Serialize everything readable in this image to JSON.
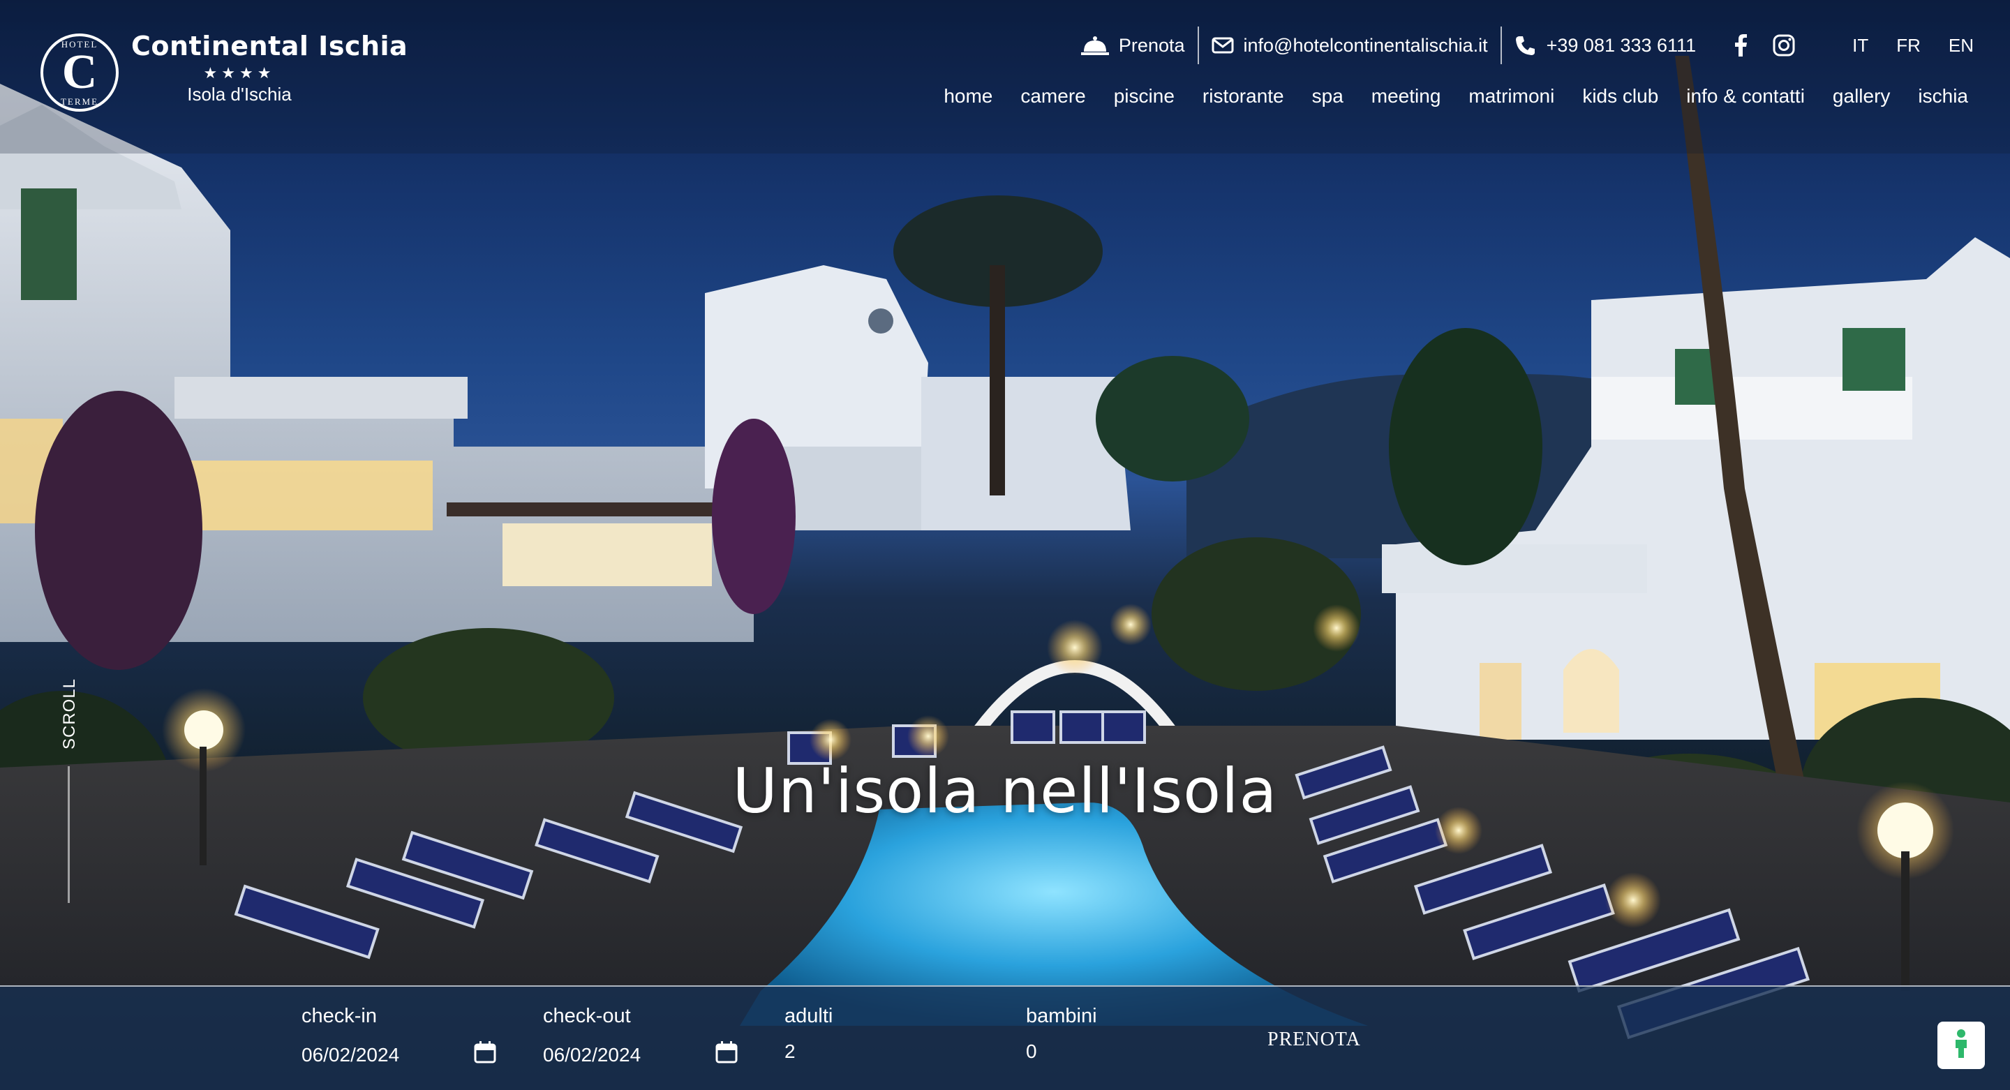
{
  "brand": {
    "logo_letter": "C",
    "logo_top": "HOTEL",
    "logo_bottom": "TERME",
    "name": "Continental Ischia",
    "stars": "★★★★",
    "location": "Isola d'Ischia"
  },
  "topbar": {
    "book_label": "Prenota",
    "book_icon": "cloche-icon",
    "email": "info@hotelcontinentalischia.it",
    "email_icon": "mail-icon",
    "phone": "+39 081 333 6111",
    "phone_icon": "phone-icon",
    "social": [
      "facebook-icon",
      "instagram-icon"
    ],
    "languages": [
      "IT",
      "FR",
      "EN"
    ]
  },
  "nav": [
    "home",
    "camere",
    "piscine",
    "ristorante",
    "spa",
    "meeting",
    "matrimoni",
    "kids club",
    "info & contatti",
    "gallery",
    "ischia"
  ],
  "hero": {
    "title": "Un'isola nell'Isola",
    "scroll_label": "SCROLL"
  },
  "booking": {
    "checkin_label": "check-in",
    "checkin_value": "06/02/2024",
    "checkout_label": "check-out",
    "checkout_value": "06/02/2024",
    "adults_label": "adulti",
    "adults_value": "2",
    "children_label": "bambini",
    "children_value": "0",
    "submit_label": "PRENOTA",
    "calendar_icon": "calendar-icon",
    "accessibility_icon": "accessibility-icon"
  },
  "colors": {
    "accent": "#ffffff",
    "booking_bar": "#163052",
    "pool": "#3fb3e8",
    "sky": "#1f4788",
    "accessibility_icon": "#2eb86b"
  }
}
